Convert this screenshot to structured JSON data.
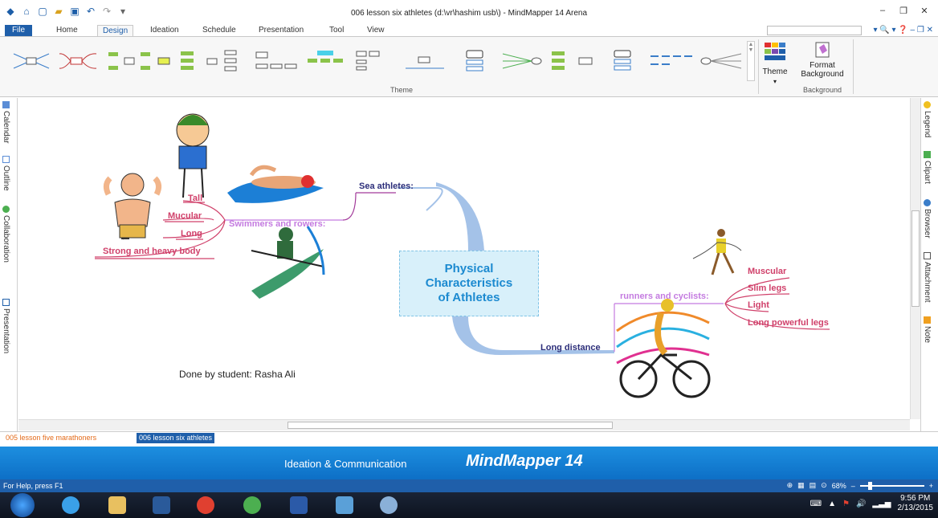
{
  "window": {
    "title": "006 lesson six athletes (d:\\vr\\hashim usb\\) - MindMapper 14 Arena"
  },
  "ribbon": {
    "tabs": [
      "File",
      "Home",
      "Design",
      "Ideation",
      "Schedule",
      "Presentation",
      "Tool",
      "View"
    ],
    "active_tab": "Design",
    "theme_group_label": "Theme",
    "theme_button": "Theme",
    "format_background_line1": "Format",
    "format_background_line2": "Background",
    "background_group_label": "Background"
  },
  "left_panel": [
    "Calendar",
    "Outline",
    "Collaboration",
    "Presentation"
  ],
  "right_panel": [
    "Legend",
    "Clipart",
    "Browser",
    "Attachment",
    "Note"
  ],
  "mindmap": {
    "central_topic": "Physical\nCharacteristics\nof Athletes",
    "branch_sea": "Sea athletes:",
    "sub_swimmers": "Swimmers and rowers:",
    "swimmers_items": [
      "Tall",
      "Mucular",
      "Long",
      "Strong and heavy body"
    ],
    "branch_long": "Long distance",
    "sub_runners": "runners and cyclists:",
    "runners_items": [
      "Muscular",
      "Slim legs",
      "Light",
      "Long powerful legs"
    ],
    "credit": "Done by student: Rasha Ali"
  },
  "doc_tabs": [
    "005 lesson five marathoners",
    "006 lesson six athletes"
  ],
  "banner": {
    "tagline": "Ideation & Communication",
    "brand": "MindMapper 14"
  },
  "status": {
    "help": "For Help, press F1",
    "zoom": "68%"
  },
  "taskbar": {
    "time": "9:56 PM",
    "date": "2/13/2015"
  }
}
